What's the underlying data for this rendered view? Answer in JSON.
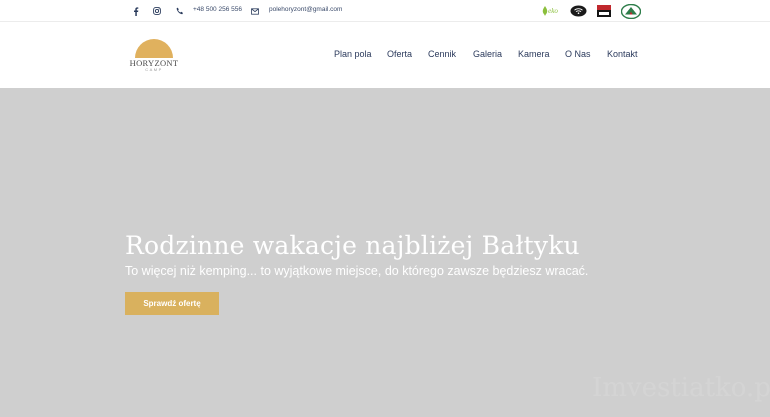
{
  "topbar": {
    "phone": "+48 500 256 556",
    "email": "polehoryzont@gmail.com",
    "icons": [
      "facebook-icon",
      "instagram-icon",
      "phone-icon",
      "mail-icon"
    ],
    "badges": [
      "eko-badge",
      "wifi-badge",
      "rooms-badge",
      "camping-badge"
    ],
    "eko_label": "eko"
  },
  "logo": {
    "name": "HORYZONT",
    "sub": "CAMP",
    "sun_color": "#e0b15e"
  },
  "nav": {
    "items": [
      "Plan pola",
      "Oferta",
      "Cennik",
      "Galeria",
      "Kamera",
      "O Nas",
      "Kontakt"
    ]
  },
  "hero": {
    "title": "Rodzinne wakacje najbliżej Bałtyku",
    "subtitle": "To więcej niż kemping... to wyjątkowe miejsce, do którego zawsze będziesz wracać.",
    "button": "Sprawdź ofertę",
    "button_color": "#d9b15e",
    "watermark": "Imvestiatko.p"
  }
}
